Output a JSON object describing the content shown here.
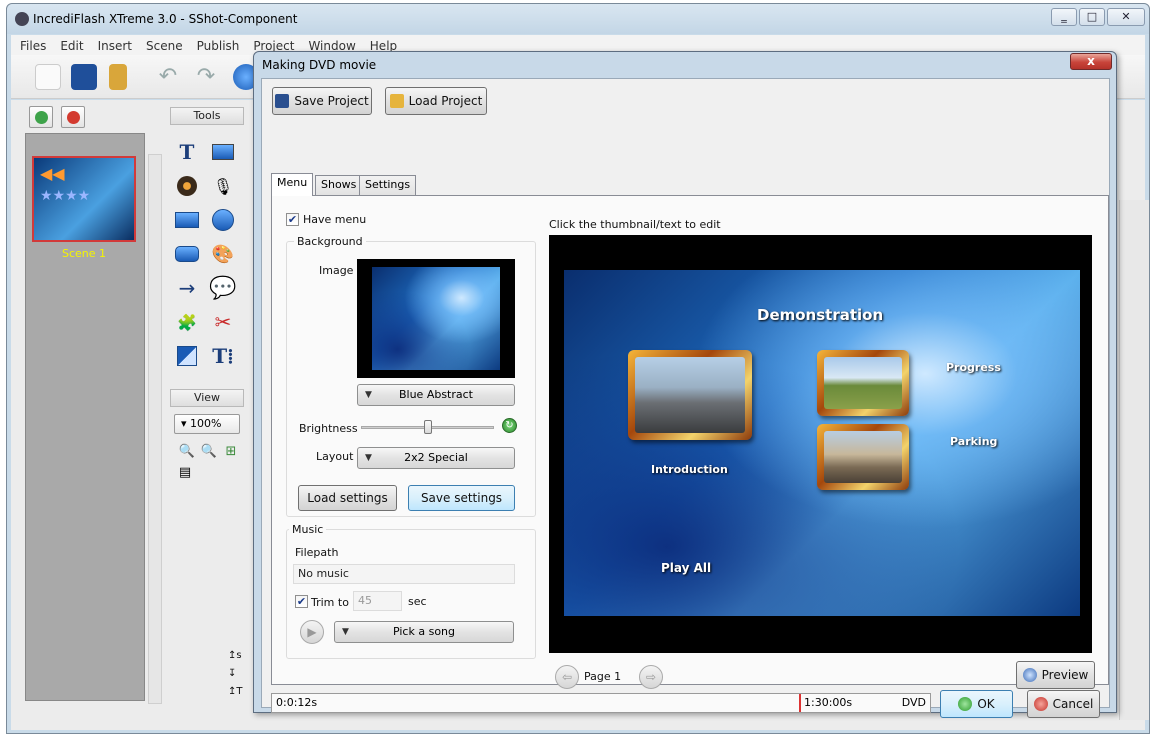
{
  "app": {
    "title": "IncrediFlash XTreme 3.0 - SShot-Component",
    "menu": [
      "Files",
      "Edit",
      "Insert",
      "Scene",
      "Publish",
      "Project",
      "Window",
      "Help"
    ],
    "caption_buttons": [
      "‗",
      "□",
      "✕"
    ]
  },
  "scenes": {
    "items": [
      {
        "label": "Scene 1"
      }
    ]
  },
  "tools_panel": {
    "header": "Tools",
    "view_header": "View",
    "zoom": "100%"
  },
  "dialog": {
    "title": "Making DVD movie",
    "close": "x",
    "save_project": "Save Project",
    "load_project": "Load Project",
    "tabs": [
      {
        "label": "Menu",
        "active": true
      },
      {
        "label": "Shows",
        "active": false
      },
      {
        "label": "Settings",
        "active": false
      }
    ],
    "menu_tab": {
      "have_menu_label": "Have menu",
      "have_menu_checked": true,
      "background_group": "Background",
      "image_label": "Image",
      "background_value": "Blue Abstract",
      "brightness_label": "Brightness",
      "brightness_level": 0.5,
      "layout_label": "Layout",
      "layout_value": "2x2 Special",
      "load_settings": "Load settings",
      "save_settings": "Save settings",
      "music_group": "Music",
      "filepath_label": "Filepath",
      "filepath_value": "No music",
      "trim_label": "Trim to",
      "trim_checked": true,
      "trim_value": "45",
      "trim_unit": "sec",
      "pick_song": "Pick a song"
    },
    "preview": {
      "hint": "Click the thumbnail/text to edit",
      "menu_title": "Demonstration",
      "items": [
        "Introduction",
        "Progress",
        "Parking"
      ],
      "play_all": "Play All",
      "page_label": "Page 1",
      "preview_button": "Preview"
    },
    "status": {
      "start_time": "0:0:12s",
      "end_time": "1:30:00s",
      "format": "DVD"
    },
    "ok": "OK",
    "cancel": "Cancel"
  }
}
